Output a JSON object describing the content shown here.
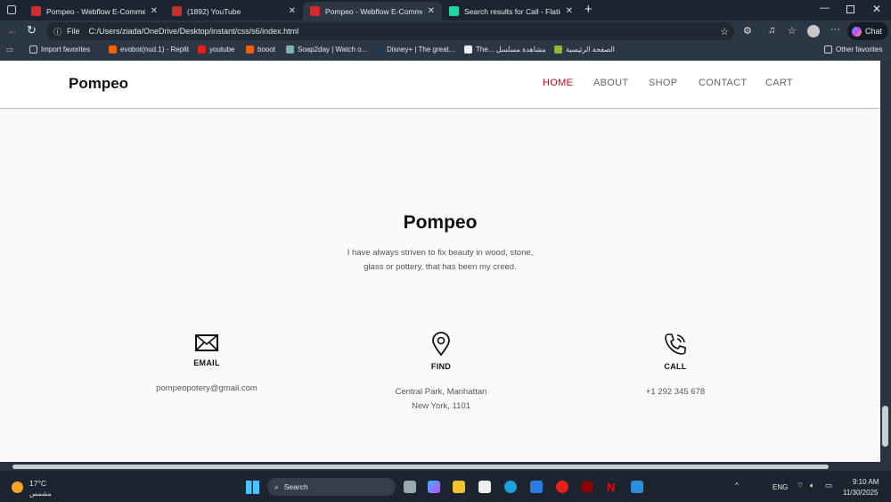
{
  "browser": {
    "tabs": [
      {
        "title": "Pompeo - Webflow E-Commerce",
        "active": false,
        "color": "#d22c2c"
      },
      {
        "title": "(1892) YouTube",
        "active": false,
        "color": "#c4302b"
      },
      {
        "title": "Pompeo - Webflow E-Commerce",
        "active": true,
        "color": "#d22c2c"
      },
      {
        "title": "Search results for Call - Flaticon",
        "active": false,
        "color": "#1ed6a0"
      }
    ],
    "address": {
      "scheme": "File",
      "url": "C:/Users/ziada/OneDrive/Desktop/instant/css/s6/index.html"
    },
    "chat_label": "Chat",
    "bookmarks": [
      "Import favorites",
      "evobot(nud.1) - Replit",
      "youtube",
      "booot",
      "Soap2day | Watch o...",
      "Disney+ | The great...",
      "The... مشاهدة مسلسل",
      "الصفحة الرئيسية"
    ],
    "other_favorites": "Other favorites"
  },
  "site": {
    "logo": "Pompeo",
    "nav": [
      {
        "label": "HOME",
        "active": true
      },
      {
        "label": "ABOUT",
        "active": false
      },
      {
        "label": "SHOP",
        "active": false
      },
      {
        "label": "CONTACT",
        "active": false
      },
      {
        "label": "CART",
        "active": false
      }
    ],
    "hero": {
      "title": "Pompeo",
      "line1": "I have always striven to fix beauty in wood, stone,",
      "line2": "glass or pottery, that has been my creed."
    },
    "contacts": [
      {
        "icon": "envelope-icon",
        "label": "EMAIL",
        "line1": "pompeopotery@gmail.com",
        "line2": ""
      },
      {
        "icon": "map-pin-icon",
        "label": "FIND",
        "line1": "Central Park, Manhattan",
        "line2": "New York, 1101"
      },
      {
        "icon": "phone-icon",
        "label": "CALL",
        "line1": "+1 292 345 678",
        "line2": ""
      }
    ],
    "accent": "#d0021b"
  },
  "taskbar": {
    "temp": "17°C",
    "weather": "مشمس",
    "search": "Search",
    "lang": "ENG",
    "time": "9:10 AM",
    "date": "11/30/2025"
  }
}
